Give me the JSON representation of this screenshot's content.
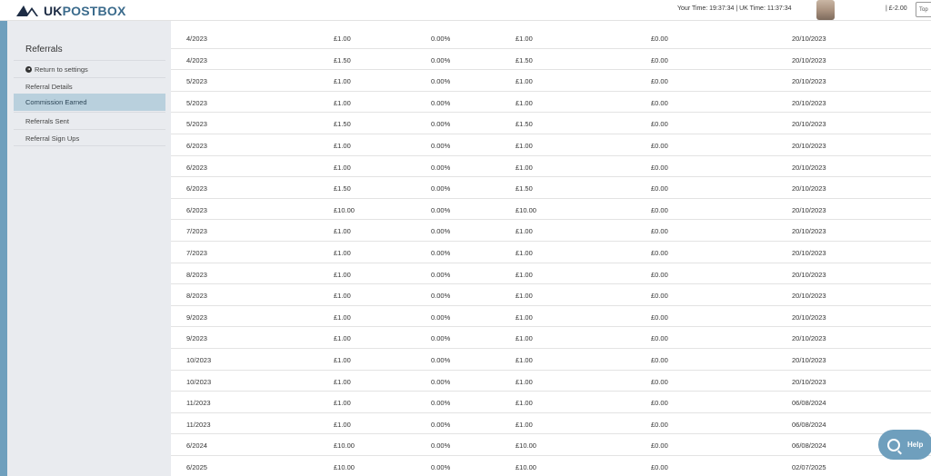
{
  "header": {
    "logo_uk": "UK",
    "logo_postbox": "POSTBOX",
    "time_info": "Your Time: 19:37:34  |  UK Time: 11:37:34",
    "balance": "| £-2.00",
    "topup_label": "Top"
  },
  "sidebar": {
    "title": "Referrals",
    "items": [
      {
        "label": "Return to settings",
        "active": false
      },
      {
        "label": "Referral Details",
        "active": false
      },
      {
        "label": "Commission Earned",
        "active": true
      },
      {
        "label": "Referrals Sent",
        "active": false
      },
      {
        "label": "Referral Sign Ups",
        "active": false
      }
    ]
  },
  "table": {
    "rows": [
      [
        "4/2023",
        "£1.00",
        "0.00%",
        "£1.00",
        "£0.00",
        "20/10/2023"
      ],
      [
        "4/2023",
        "£1.50",
        "0.00%",
        "£1.50",
        "£0.00",
        "20/10/2023"
      ],
      [
        "5/2023",
        "£1.00",
        "0.00%",
        "£1.00",
        "£0.00",
        "20/10/2023"
      ],
      [
        "5/2023",
        "£1.00",
        "0.00%",
        "£1.00",
        "£0.00",
        "20/10/2023"
      ],
      [
        "5/2023",
        "£1.50",
        "0.00%",
        "£1.50",
        "£0.00",
        "20/10/2023"
      ],
      [
        "6/2023",
        "£1.00",
        "0.00%",
        "£1.00",
        "£0.00",
        "20/10/2023"
      ],
      [
        "6/2023",
        "£1.00",
        "0.00%",
        "£1.00",
        "£0.00",
        "20/10/2023"
      ],
      [
        "6/2023",
        "£1.50",
        "0.00%",
        "£1.50",
        "£0.00",
        "20/10/2023"
      ],
      [
        "6/2023",
        "£10.00",
        "0.00%",
        "£10.00",
        "£0.00",
        "20/10/2023"
      ],
      [
        "7/2023",
        "£1.00",
        "0.00%",
        "£1.00",
        "£0.00",
        "20/10/2023"
      ],
      [
        "7/2023",
        "£1.00",
        "0.00%",
        "£1.00",
        "£0.00",
        "20/10/2023"
      ],
      [
        "8/2023",
        "£1.00",
        "0.00%",
        "£1.00",
        "£0.00",
        "20/10/2023"
      ],
      [
        "8/2023",
        "£1.00",
        "0.00%",
        "£1.00",
        "£0.00",
        "20/10/2023"
      ],
      [
        "9/2023",
        "£1.00",
        "0.00%",
        "£1.00",
        "£0.00",
        "20/10/2023"
      ],
      [
        "9/2023",
        "£1.00",
        "0.00%",
        "£1.00",
        "£0.00",
        "20/10/2023"
      ],
      [
        "10/2023",
        "£1.00",
        "0.00%",
        "£1.00",
        "£0.00",
        "20/10/2023"
      ],
      [
        "10/2023",
        "£1.00",
        "0.00%",
        "£1.00",
        "£0.00",
        "20/10/2023"
      ],
      [
        "11/2023",
        "£1.00",
        "0.00%",
        "£1.00",
        "£0.00",
        "06/08/2024"
      ],
      [
        "11/2023",
        "£1.00",
        "0.00%",
        "£1.00",
        "£0.00",
        "06/08/2024"
      ],
      [
        "6/2024",
        "£10.00",
        "0.00%",
        "£10.00",
        "£0.00",
        "06/08/2024"
      ],
      [
        "6/2025",
        "£10.00",
        "0.00%",
        "£10.00",
        "£0.00",
        "02/07/2025"
      ]
    ]
  },
  "help": {
    "label": "Help",
    "icon": "search-icon"
  },
  "colors": {
    "accent": "#6f9fbd",
    "active_item": "#b9d0dd",
    "brand_dark": "#1d2c44"
  }
}
